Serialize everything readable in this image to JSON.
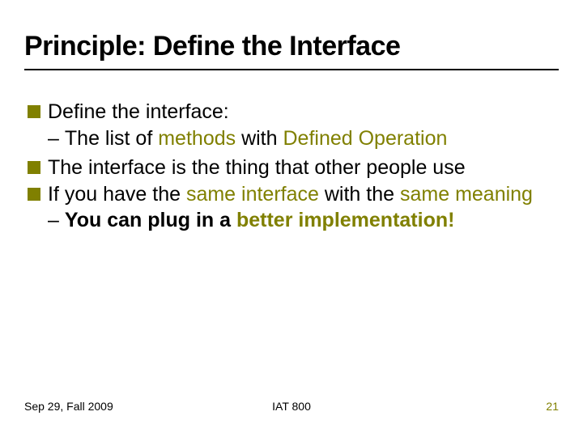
{
  "title": "Principle: Define the Interface",
  "bullets": {
    "b1": {
      "segs": {
        "s0": "Define the interface:"
      }
    },
    "b1a": {
      "segs": {
        "s0": "The list of ",
        "s1": "methods",
        "s2": " with ",
        "s3": "Defined Operation"
      }
    },
    "b2": {
      "segs": {
        "s0": "The interface is the thing that other people use"
      }
    },
    "b3": {
      "segs": {
        "s0": "If you have the ",
        "s1": "same interface",
        "s2": " with the ",
        "s3": "same meaning"
      }
    },
    "b3a": {
      "segs": {
        "s0": "You can plug in a ",
        "s1": "better implementation!"
      }
    }
  },
  "footer": {
    "left": "Sep 29, Fall 2009",
    "center": "IAT 800",
    "right": "21"
  },
  "colors": {
    "accent": "#808000"
  }
}
